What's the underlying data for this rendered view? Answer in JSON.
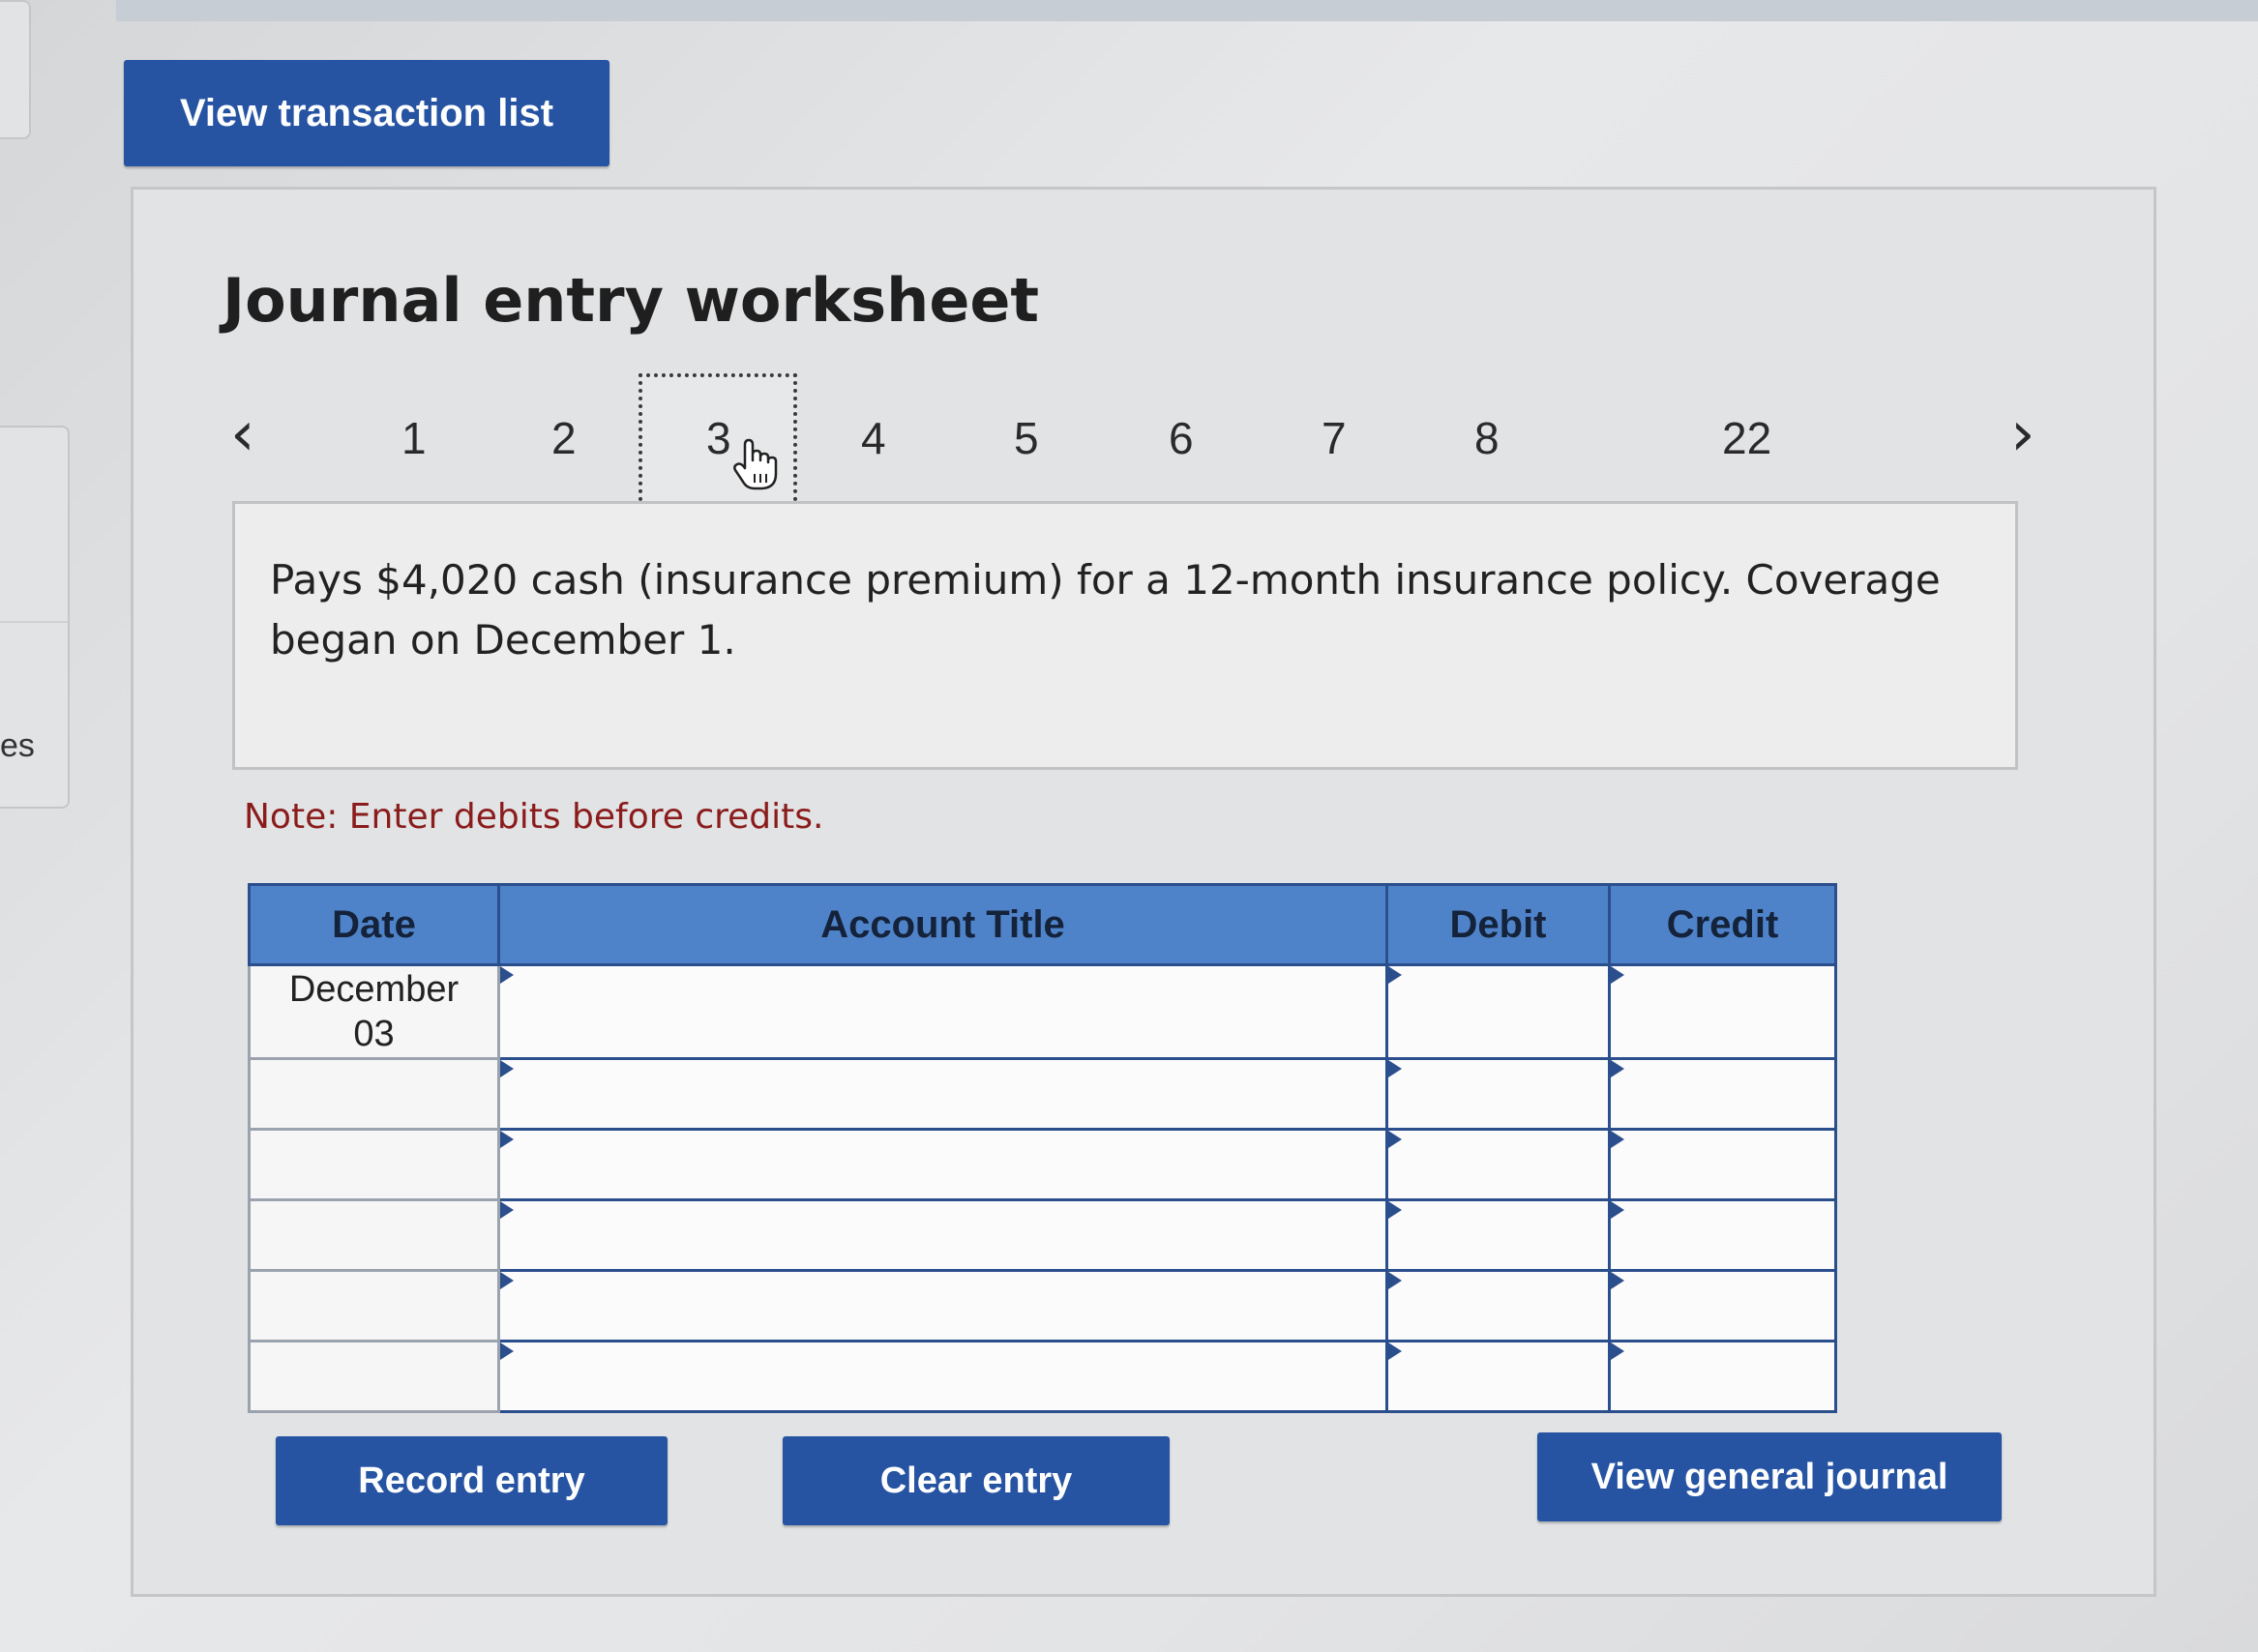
{
  "header": {
    "view_transaction_list_label": "View transaction list"
  },
  "side_tab": {
    "text": "es"
  },
  "worksheet": {
    "title": "Journal entry worksheet",
    "pager": {
      "prev_icon": "chevron-left-icon",
      "next_icon": "chevron-right-icon",
      "pages": [
        "1",
        "2",
        "3",
        "4",
        "5",
        "6",
        "7",
        "8",
        "22"
      ],
      "selected": "3"
    },
    "description": "Pays $4,020 cash (insurance premium) for a 12-month insurance policy. Coverage began on December 1.",
    "note": "Note: Enter debits before credits.",
    "table": {
      "headers": {
        "date": "Date",
        "account_title": "Account Title",
        "debit": "Debit",
        "credit": "Credit"
      },
      "rows": [
        {
          "date": "December\n03"
        },
        {
          "date": ""
        },
        {
          "date": ""
        },
        {
          "date": ""
        },
        {
          "date": ""
        },
        {
          "date": ""
        }
      ]
    },
    "buttons": {
      "record_entry": "Record entry",
      "clear_entry": "Clear entry",
      "view_general_journal": "View general journal"
    }
  },
  "colors": {
    "button_bg": "#2654a2",
    "header_bg": "#4f83c9",
    "note_text": "#8b1c1c"
  }
}
